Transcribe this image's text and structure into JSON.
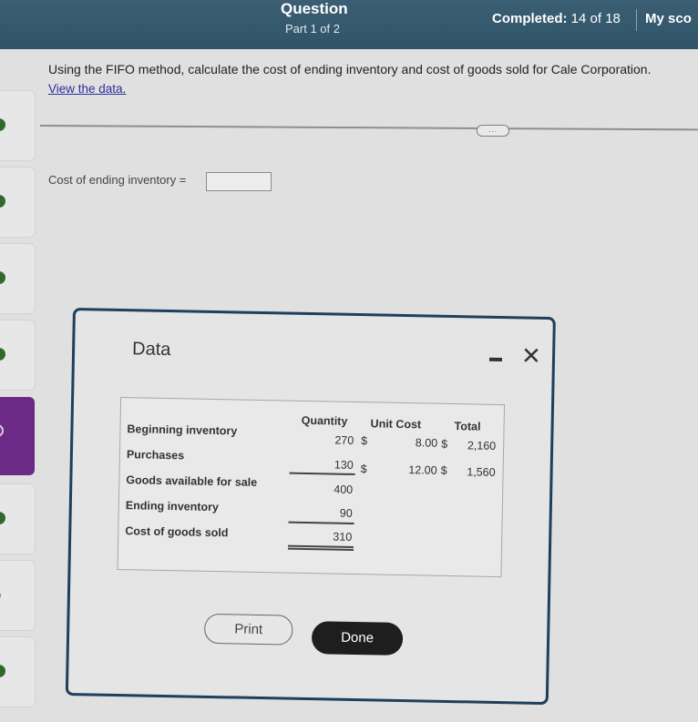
{
  "header": {
    "title": "Question",
    "part": "Part 1 of 2",
    "completed_label": "Completed:",
    "completed_value": "14 of 18",
    "score_label": "My sco"
  },
  "sidebar": {
    "items": [
      {
        "status": "complete"
      },
      {
        "status": "complete"
      },
      {
        "status": "complete"
      },
      {
        "status": "complete"
      },
      {
        "status": "active"
      },
      {
        "status": "complete"
      },
      {
        "status": "partial"
      },
      {
        "status": "complete"
      }
    ]
  },
  "question": {
    "text": "Using the FIFO method, calculate the cost of ending inventory and cost of goods sold for Cale Corporation.",
    "view_data_link": "View the data.",
    "more_button": "...",
    "answer_label": "Cost of ending inventory =",
    "answer_value": ""
  },
  "modal": {
    "title": "Data",
    "minimize_icon": "minus-icon",
    "close_icon": "close-icon",
    "table": {
      "headers": {
        "quantity": "Quantity",
        "unit_cost": "Unit Cost",
        "total": "Total"
      },
      "rows": [
        {
          "label": "Beginning inventory",
          "quantity": "270",
          "cur1": "$",
          "unit_cost": "8.00",
          "cur2": "$",
          "total": "2,160"
        },
        {
          "label": "Purchases",
          "quantity": "130",
          "cur1": "$",
          "unit_cost": "12.00",
          "cur2": "$",
          "total": "1,560"
        },
        {
          "label": "Goods available for sale",
          "quantity": "400"
        },
        {
          "label": "Ending inventory",
          "quantity": "90"
        },
        {
          "label": "Cost of goods sold",
          "quantity": "310"
        }
      ]
    },
    "print_button": "Print",
    "done_button": "Done"
  },
  "colors": {
    "header_bg": "#2f5468",
    "active_tab": "#6b2a86",
    "complete_dot": "#2f6a2c",
    "link": "#2e2e9a",
    "modal_border": "#1f3f5c",
    "done_bg": "#1e1e1e"
  }
}
